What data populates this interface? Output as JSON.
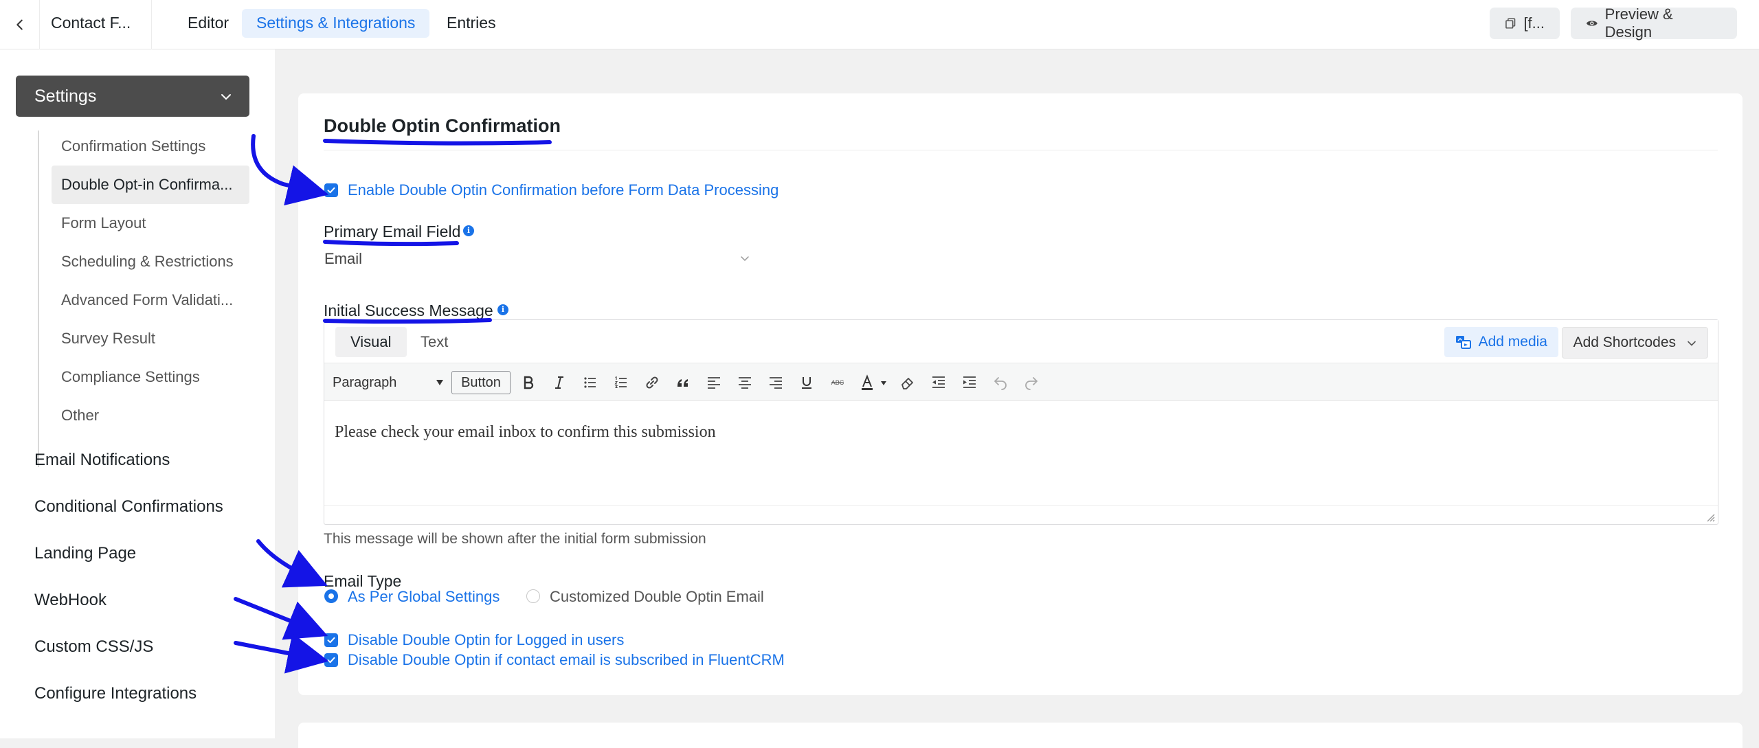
{
  "topbar": {
    "form_name": "Contact F...",
    "tabs": [
      {
        "label": "Editor",
        "active": false
      },
      {
        "label": "Settings & Integrations",
        "active": true
      },
      {
        "label": "Entries",
        "active": false
      }
    ],
    "shortcode_button": "[f...",
    "preview_button": "Preview & Design"
  },
  "sidebar": {
    "settings_label": "Settings",
    "sub_items": [
      {
        "label": "Confirmation Settings",
        "active": false
      },
      {
        "label": "Double Opt-in Confirma...",
        "active": true
      },
      {
        "label": "Form Layout",
        "active": false
      },
      {
        "label": "Scheduling & Restrictions",
        "active": false
      },
      {
        "label": "Advanced Form Validati...",
        "active": false
      },
      {
        "label": "Survey Result",
        "active": false
      },
      {
        "label": "Compliance Settings",
        "active": false
      },
      {
        "label": "Other",
        "active": false
      }
    ],
    "nav_items": [
      {
        "label": "Email Notifications"
      },
      {
        "label": "Conditional Confirmations"
      },
      {
        "label": "Landing Page"
      },
      {
        "label": "WebHook"
      },
      {
        "label": "Custom CSS/JS"
      },
      {
        "label": "Configure Integrations"
      }
    ]
  },
  "main": {
    "title": "Double Optin Confirmation",
    "enable_checkbox": {
      "label": "Enable Double Optin Confirmation before Form Data Processing",
      "checked": true
    },
    "primary_email": {
      "label": "Primary Email Field",
      "value": "Email"
    },
    "initial_message": {
      "label": "Initial Success Message",
      "tabs": [
        "Visual",
        "Text"
      ],
      "active_tab": "Visual",
      "add_media": "Add media",
      "add_shortcodes": "Add Shortcodes",
      "format_select": "Paragraph",
      "button_label": "Button",
      "toolbar_icons": [
        "bold-icon",
        "italic-icon",
        "bullet-list-icon",
        "numbered-list-icon",
        "link-icon",
        "blockquote-icon",
        "align-left-icon",
        "align-center-icon",
        "align-right-icon",
        "underline-icon",
        "strikethrough-icon",
        "text-color-icon",
        "eraser-icon",
        "outdent-icon",
        "indent-icon",
        "undo-icon",
        "redo-icon"
      ],
      "content": "Please check your email inbox to confirm this submission",
      "help_text": "This message will be shown after the initial form submission"
    },
    "email_type": {
      "label": "Email Type",
      "options": [
        {
          "label": "As Per Global Settings",
          "selected": true
        },
        {
          "label": "Customized Double Optin Email",
          "selected": false
        }
      ]
    },
    "disable_logged_in": {
      "label": "Disable Double Optin for Logged in users",
      "checked": true
    },
    "disable_fluentcrm": {
      "label": "Disable Double Optin if contact email is subscribed in FluentCRM",
      "checked": true
    }
  },
  "colors": {
    "accent": "#1a73e8",
    "annotation": "#1414e6",
    "sidebar_header": "#4c4c4c"
  }
}
